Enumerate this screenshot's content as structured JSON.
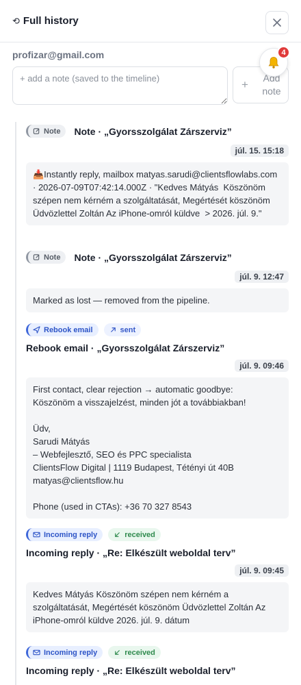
{
  "header": {
    "title": "Full history",
    "icon": "history-icon"
  },
  "account": {
    "email": "profizar@gmail.com"
  },
  "notifications": {
    "count": "4"
  },
  "note": {
    "placeholder": "+ add a note (saved to the timeline)",
    "value": "",
    "add_label": "Add note"
  },
  "entries": [
    {
      "type_label": "Note",
      "title": "Note · „Gyorsszolgálat Zárszerviz”",
      "timestamp": "júl. 15. 15:18",
      "body": "📥Instantly reply, mailbox matyas.sarudi@clientsflowlabs.com · 2026-07-09T07:42:14.000Z · \"Kedves Mátyás  Köszönöm szépen nem kérném a szolgáltatását, Megértését köszönöm  Üdvözlettel Zoltán Az iPhone-omról küldve  > 2026. júl. 9.\""
    },
    {
      "type_label": "Note",
      "title": "Note · „Gyorsszolgálat Zárszerviz”",
      "timestamp": "júl. 9. 12:47",
      "body": "Marked as lost — removed from the pipeline."
    },
    {
      "type_label": "Rebook email",
      "status": "sent",
      "title": "Rebook email · „Gyorsszolgálat Zárszerviz”",
      "timestamp": "júl. 9. 09:46",
      "body": "First contact, clear rejection → automatic goodbye:\nKöszönöm a visszajelzést, minden jót a továbbiakban!\n\nÜdv,\nSarudi Mátyás\n– Webfejlesztő, SEO és PPC specialista\nClientsFlow Digital | 1119 Budapest, Tétényi út 40B\nmatyas@clientsflow.hu\n\nPhone (used in CTAs): +36 70 327 8543"
    },
    {
      "type_label": "Incoming reply",
      "status": "received",
      "title": "Incoming reply · „Re: Elkészült weboldal terv”",
      "timestamp": "júl. 9. 09:45",
      "body": "Kedves Mátyás Köszönöm szépen nem kérném a szolgáltatását, Megértését köszönöm Üdvözlettel Zoltán Az iPhone-omról küldve 2026. júl. 9. dátum"
    },
    {
      "type_label": "Incoming reply",
      "status": "received",
      "title": "Incoming reply · „Re: Elkészült weboldal terv”"
    }
  ]
}
